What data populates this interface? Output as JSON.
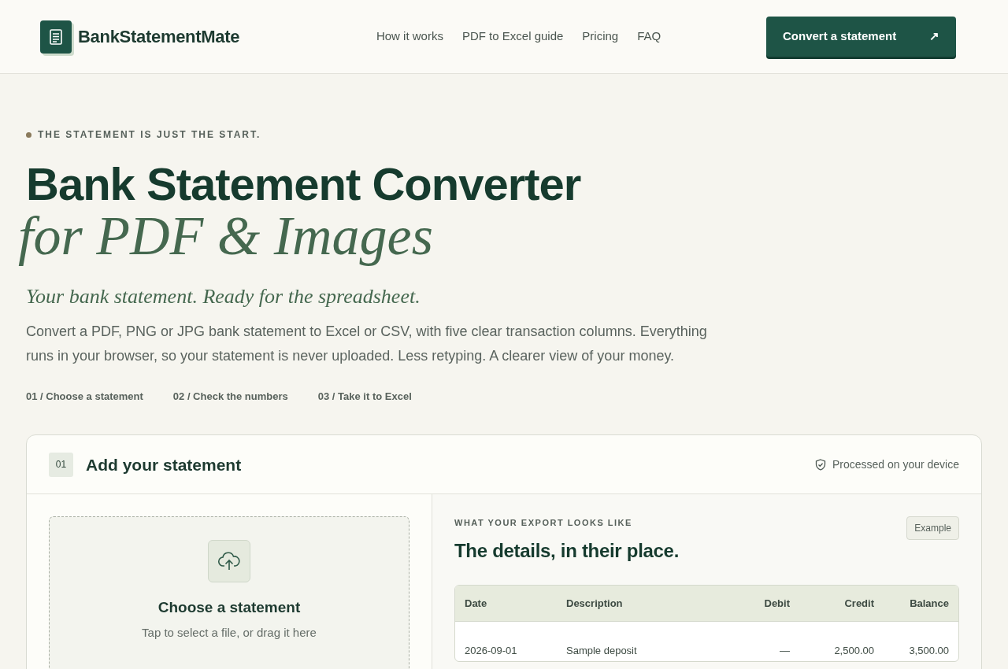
{
  "header": {
    "brand": "BankStatementMate",
    "nav": [
      {
        "label": "How it works"
      },
      {
        "label": "PDF to Excel guide"
      },
      {
        "label": "Pricing"
      },
      {
        "label": "FAQ"
      }
    ],
    "cta": {
      "label": "Convert a statement",
      "arrow": "↗"
    }
  },
  "hero": {
    "eyebrow": "THE STATEMENT IS JUST THE START.",
    "title": "Bank Statement Converter",
    "title_italic": "for PDF & Images",
    "tagline": "Your bank statement. Ready for the spreadsheet.",
    "description": "Convert a PDF, PNG or JPG bank statement to Excel or CSV, with five clear transaction columns. Everything runs in your browser, so your statement is never uploaded. Less retyping. A clearer view of your money.",
    "steps": [
      "01 / Choose a statement",
      "02 / Check the numbers",
      "03 / Take it to Excel"
    ]
  },
  "panel": {
    "step": "01",
    "title": "Add your statement",
    "privacy_note": "Processed on your device",
    "dropzone": {
      "title": "Choose a statement",
      "hint": "Tap to select a file, or drag it here"
    },
    "preview": {
      "eyebrow": "WHAT YOUR EXPORT LOOKS LIKE",
      "badge": "Example",
      "title": "The details, in their place.",
      "table": {
        "columns": [
          "Date",
          "Description",
          "Debit",
          "Credit",
          "Balance"
        ],
        "rows": [
          [
            "2026-09-01",
            "Sample deposit",
            "—",
            "2,500.00",
            "3,500.00"
          ]
        ]
      }
    }
  }
}
